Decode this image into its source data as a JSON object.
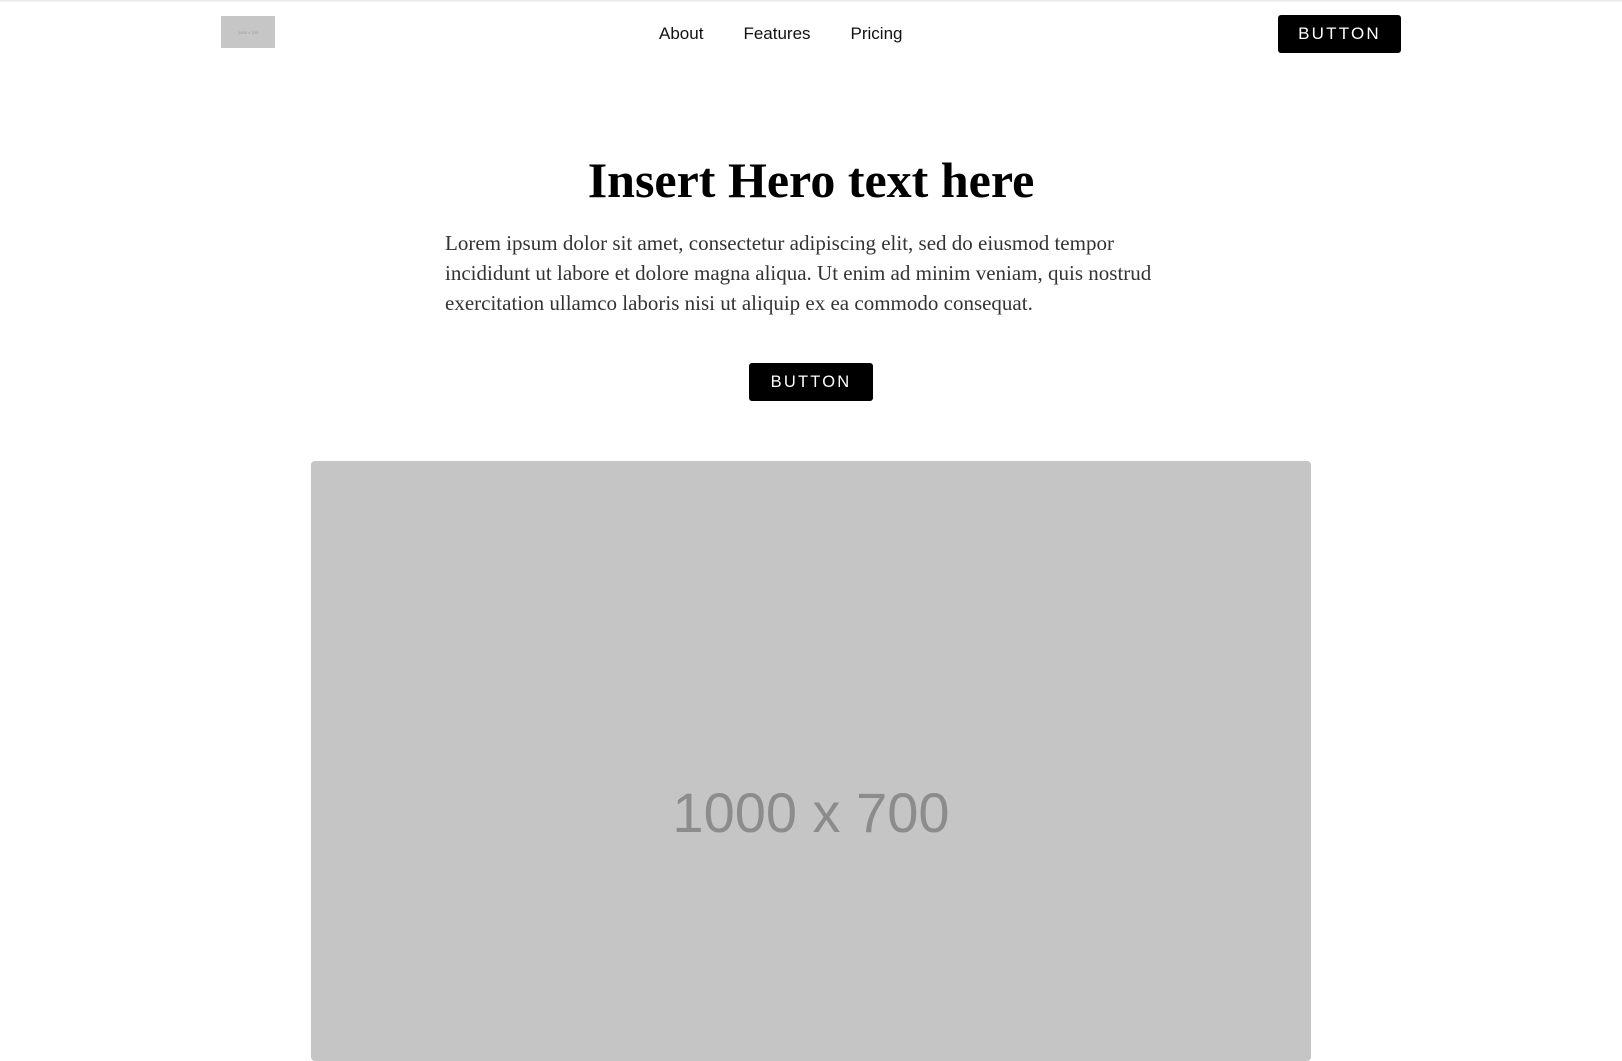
{
  "nav": {
    "logo_text": "1000 x 700",
    "links": [
      {
        "label": "About"
      },
      {
        "label": "Features"
      },
      {
        "label": "Pricing"
      }
    ],
    "button_label": "BUTTON"
  },
  "hero": {
    "title": "Insert Hero text here",
    "body": "Lorem ipsum dolor sit amet, consectetur adipiscing elit, sed do eiusmod tempor incididunt ut labore et dolore magna aliqua. Ut enim ad minim veniam, quis nostrud exercitation ullamco laboris nisi ut aliquip ex ea commodo consequat.",
    "button_label": "BUTTON",
    "image_placeholder": "1000 x 700"
  },
  "colors": {
    "button_bg": "#000000",
    "placeholder_bg": "#c5c5c5",
    "placeholder_text": "#8c8c8c"
  }
}
